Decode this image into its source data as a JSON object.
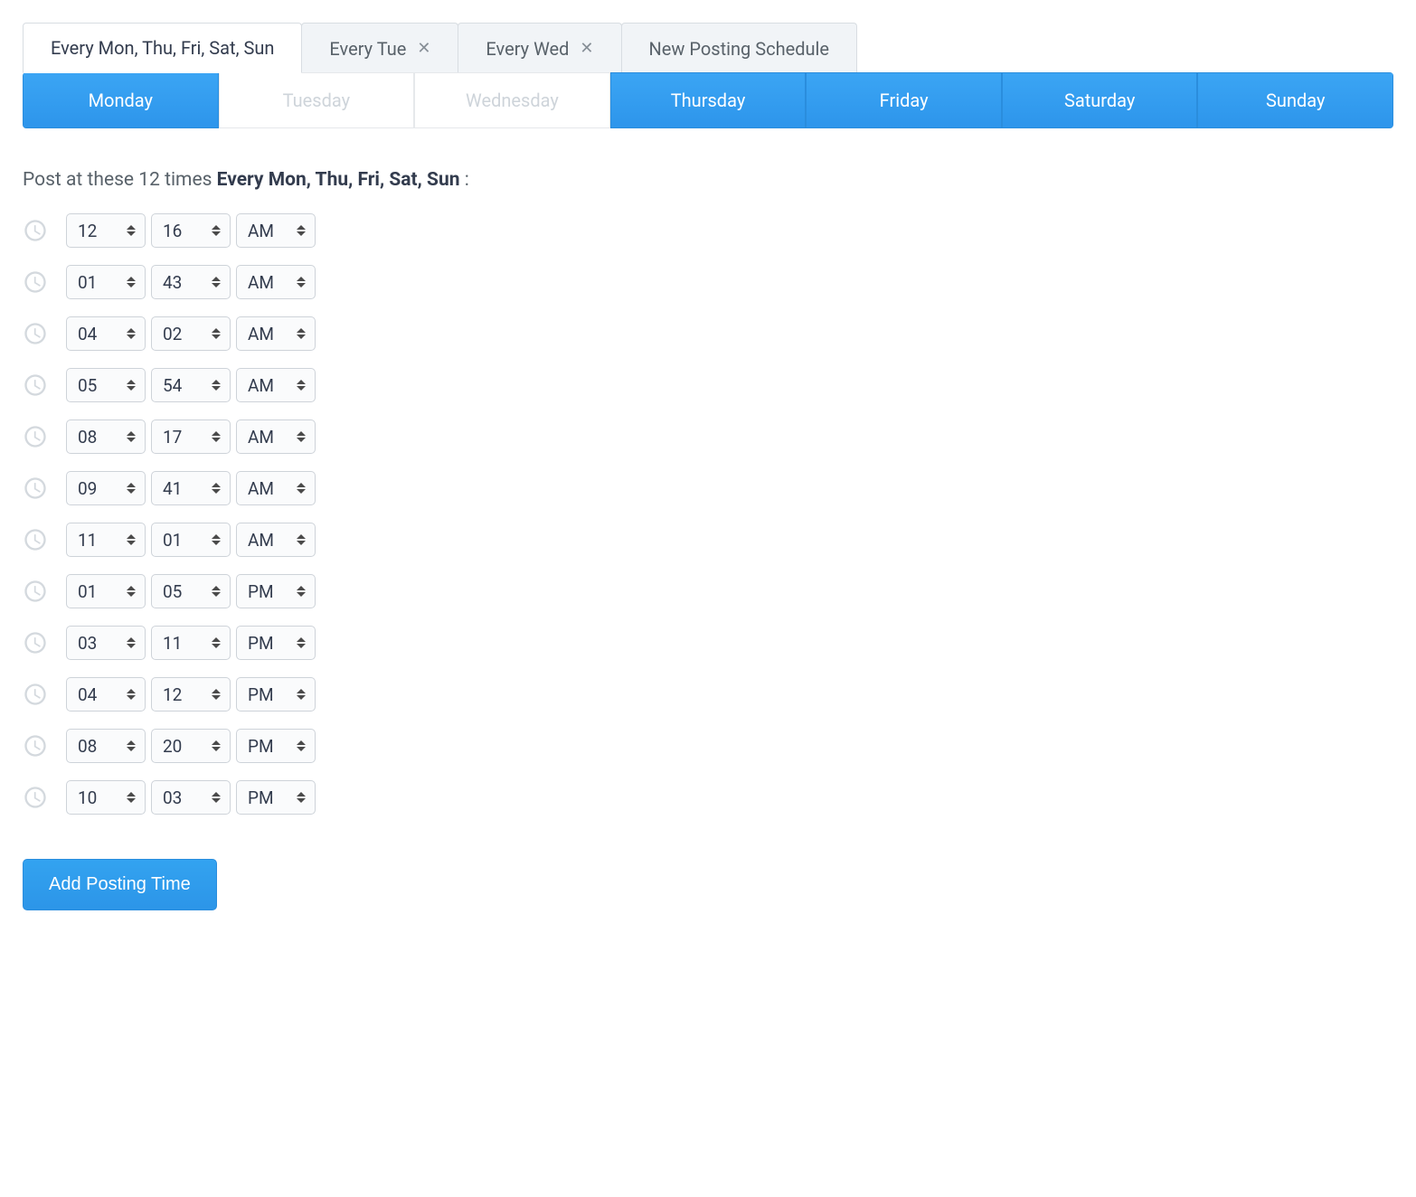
{
  "schedule_tabs": [
    {
      "label": "Every Mon, Thu, Fri, Sat, Sun",
      "active": true,
      "closable": false
    },
    {
      "label": "Every Tue",
      "active": false,
      "closable": true
    },
    {
      "label": "Every Wed",
      "active": false,
      "closable": true
    },
    {
      "label": "New Posting Schedule",
      "active": false,
      "closable": false
    }
  ],
  "day_tabs": [
    {
      "label": "Monday",
      "selected": true
    },
    {
      "label": "Tuesday",
      "selected": false
    },
    {
      "label": "Wednesday",
      "selected": false
    },
    {
      "label": "Thursday",
      "selected": true
    },
    {
      "label": "Friday",
      "selected": true
    },
    {
      "label": "Saturday",
      "selected": true
    },
    {
      "label": "Sunday",
      "selected": true
    }
  ],
  "heading": {
    "prefix": "Post at these 12 times ",
    "bold": "Every Mon, Thu, Fri, Sat, Sun",
    "suffix": " :"
  },
  "times": [
    {
      "hour": "12",
      "minute": "16",
      "period": "AM"
    },
    {
      "hour": "01",
      "minute": "43",
      "period": "AM"
    },
    {
      "hour": "04",
      "minute": "02",
      "period": "AM"
    },
    {
      "hour": "05",
      "minute": "54",
      "period": "AM"
    },
    {
      "hour": "08",
      "minute": "17",
      "period": "AM"
    },
    {
      "hour": "09",
      "minute": "41",
      "period": "AM"
    },
    {
      "hour": "11",
      "minute": "01",
      "period": "AM"
    },
    {
      "hour": "01",
      "minute": "05",
      "period": "PM"
    },
    {
      "hour": "03",
      "minute": "11",
      "period": "PM"
    },
    {
      "hour": "04",
      "minute": "12",
      "period": "PM"
    },
    {
      "hour": "08",
      "minute": "20",
      "period": "PM"
    },
    {
      "hour": "10",
      "minute": "03",
      "period": "PM"
    }
  ],
  "add_button": "Add Posting Time"
}
